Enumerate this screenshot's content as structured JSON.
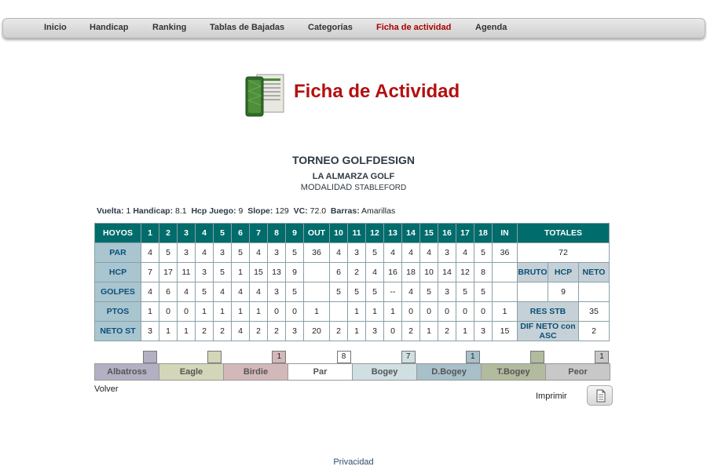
{
  "nav": [
    "Inicio",
    "Handicap",
    "Ranking",
    "Tablas de Bajadas",
    "Categorías",
    "Ficha de actividad",
    "Agenda"
  ],
  "nav_active": 5,
  "title": "Ficha de Actividad",
  "tournament": {
    "name": "TORNEO GOLFDESIGN",
    "club": "LA ALMARZA GOLF",
    "modality_label": "MODALIDAD",
    "modality_value": "STABLEFORD"
  },
  "info": [
    {
      "label": "Vuelta:",
      "value": "1"
    },
    {
      "label": "Handicap:",
      "value": "8.1"
    },
    {
      "label": "Hcp Juego:",
      "value": "9"
    },
    {
      "label": "Slope:",
      "value": "129"
    },
    {
      "label": "VC:",
      "value": "72.0"
    },
    {
      "label": "Barras:",
      "value": "Amarillas"
    }
  ],
  "scorecard": {
    "header": [
      "HOYOS",
      "1",
      "2",
      "3",
      "4",
      "5",
      "6",
      "7",
      "8",
      "9",
      "OUT",
      "10",
      "11",
      "12",
      "13",
      "14",
      "15",
      "16",
      "17",
      "18",
      "IN"
    ],
    "rows": [
      {
        "label": "PAR",
        "cells": [
          "4",
          "5",
          "3",
          "4",
          "3",
          "5",
          "4",
          "3",
          "5",
          "36",
          "4",
          "3",
          "5",
          "4",
          "4",
          "4",
          "3",
          "4",
          "5",
          "36"
        ]
      },
      {
        "label": "HCP",
        "cells": [
          "7",
          "17",
          "11",
          "3",
          "5",
          "1",
          "15",
          "13",
          "9",
          "",
          "6",
          "2",
          "4",
          "16",
          "18",
          "10",
          "14",
          "12",
          "8",
          ""
        ]
      },
      {
        "label": "GOLPES",
        "cells": [
          "4",
          "6",
          "4",
          "5",
          "4",
          "4",
          "4",
          "3",
          "5",
          "",
          "5",
          "5",
          "5",
          "--",
          "4",
          "5",
          "3",
          "5",
          "5",
          ""
        ],
        "colors": [
          "",
          "bogey",
          "bogey",
          "bogey",
          "bogey",
          "birdie",
          "",
          "",
          "",
          "",
          "bogey",
          "dbogey",
          "",
          "peor",
          "",
          "bogey",
          "",
          "bogey",
          "",
          ""
        ]
      },
      {
        "label": "PTOS",
        "cells": [
          "1",
          "0",
          "0",
          "1",
          "1",
          "1",
          "1",
          "0",
          "0",
          "1",
          "",
          "1",
          "1",
          "1",
          "0",
          "0",
          "0",
          "0",
          "0",
          "1"
        ]
      },
      {
        "label": "NETO ST",
        "cells": [
          "3",
          "1",
          "1",
          "2",
          "2",
          "4",
          "2",
          "2",
          "3",
          "20",
          "2",
          "1",
          "3",
          "0",
          "2",
          "1",
          "2",
          "1",
          "3",
          "15"
        ]
      }
    ],
    "totals_header": "TOTALES",
    "total_value": "72",
    "subheaders": [
      "BRUTO",
      "HCP",
      "NETO"
    ],
    "subvalues": [
      "",
      "9",
      ""
    ],
    "res_stb_label": "RES STB",
    "res_stb_value": "35",
    "dif_label": "DIF NETO con ASC",
    "dif_value": "2"
  },
  "distribution": {
    "categories": [
      "Albatross",
      "Eagle",
      "Birdie",
      "Par",
      "Bogey",
      "D.Bogey",
      "T.Bogey",
      "Peor"
    ],
    "counts": [
      0,
      0,
      1,
      8,
      7,
      1,
      0,
      1
    ]
  },
  "back_label": "Volver",
  "print_label": "Imprimir",
  "footer": "Privacidad",
  "colors": {
    "header_teal": "#006c6b",
    "title_red": "#b50f0f",
    "albatross": "#b3b0c4",
    "eagle": "#d3d6b8",
    "birdie": "#d3b8ba",
    "par": "#ffffff",
    "bogey": "#cfdfe2",
    "dbogey": "#a7c0ca",
    "tbogey": "#b2bb9e",
    "peor": "#c8c8c8"
  }
}
